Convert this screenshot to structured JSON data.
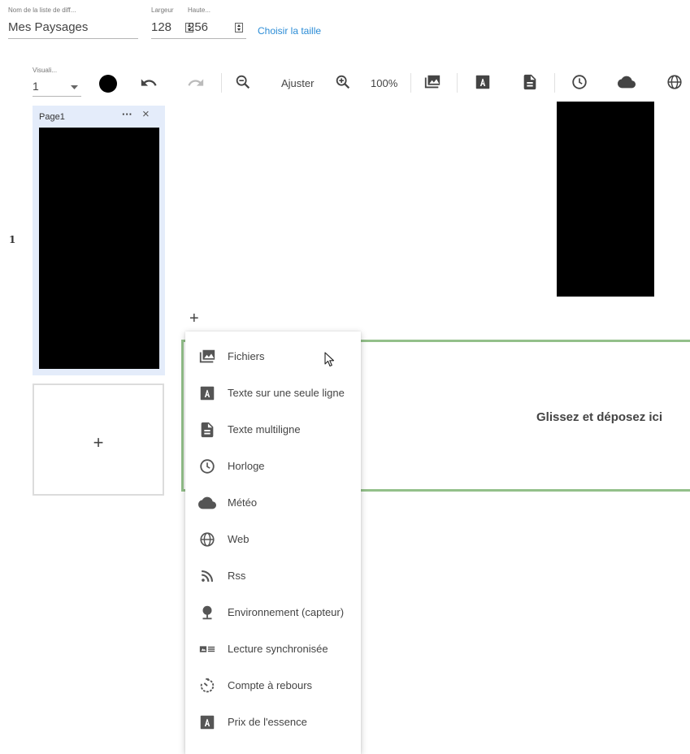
{
  "form": {
    "name_label": "Nom de la liste de diff...",
    "name_value": "Mes Paysages",
    "width_label": "Largeur",
    "width_value": "128",
    "height_label": "Haute...",
    "height_value": "256",
    "choose_size_link": "Choisir la taille"
  },
  "toolbar": {
    "view_label": "Visuali...",
    "view_value": "1",
    "fit_label": "Ajuster",
    "zoom_value": "100%",
    "color_swatch": "#000000"
  },
  "pages": {
    "row_number": "1",
    "items": [
      {
        "title": "Page1",
        "more_label": "···",
        "close_label": "×"
      }
    ],
    "add_page_label": "+"
  },
  "canvas": {
    "add_zone_label": "+",
    "drop_zone_text": "Glissez et déposez ici"
  },
  "menu": {
    "items": [
      {
        "label": "Fichiers",
        "icon": "image-icon"
      },
      {
        "label": "Texte sur une seule ligne",
        "icon": "text-a-icon"
      },
      {
        "label": "Texte multiligne",
        "icon": "document-icon"
      },
      {
        "label": "Horloge",
        "icon": "clock-icon"
      },
      {
        "label": "Météo",
        "icon": "cloud-icon"
      },
      {
        "label": "Web",
        "icon": "globe-icon"
      },
      {
        "label": "Rss",
        "icon": "rss-icon"
      },
      {
        "label": "Environnement (capteur)",
        "icon": "sensor-icon"
      },
      {
        "label": "Lecture synchronisée",
        "icon": "sync-play-icon"
      },
      {
        "label": "Compte à rebours",
        "icon": "countdown-icon"
      },
      {
        "label": "Prix de l'essence",
        "icon": "text-a-icon"
      }
    ]
  },
  "colors": {
    "accent_link": "#2b8cd6",
    "selected_page_bg": "#e4ecfa",
    "drop_zone_border": "#93c08a",
    "icon": "#555555"
  }
}
